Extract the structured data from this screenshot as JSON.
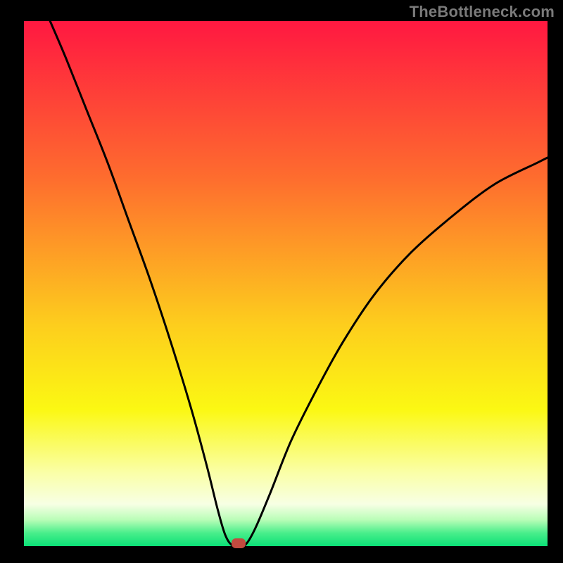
{
  "watermark": "TheBottleneck.com",
  "chart_data": {
    "type": "line",
    "title": "",
    "xlabel": "",
    "ylabel": "",
    "xlim": [
      0,
      100
    ],
    "ylim": [
      0,
      100
    ],
    "notes": "V-shaped bottleneck curve centered near x≈41. Background gradient top→bottom: red→orange→yellow→cream with a thin green band at bottom and a small red marker at the minimum. No axis ticks or labels visible.",
    "marker": {
      "x": 41,
      "y": 0,
      "color": "#c24a3f"
    },
    "gradient_stops": [
      {
        "offset": 0,
        "color": "#ff1841"
      },
      {
        "offset": 30,
        "color": "#fe6d2e"
      },
      {
        "offset": 58,
        "color": "#fdce1d"
      },
      {
        "offset": 74,
        "color": "#fbf813"
      },
      {
        "offset": 86,
        "color": "#faffa7"
      },
      {
        "offset": 92,
        "color": "#f7ffe4"
      },
      {
        "offset": 95,
        "color": "#b9fdb7"
      },
      {
        "offset": 97.5,
        "color": "#49ee8b"
      },
      {
        "offset": 100,
        "color": "#0be077"
      }
    ],
    "curve_points": [
      {
        "x": 5,
        "y": 100
      },
      {
        "x": 8,
        "y": 93
      },
      {
        "x": 12,
        "y": 83
      },
      {
        "x": 16,
        "y": 73
      },
      {
        "x": 20,
        "y": 62
      },
      {
        "x": 24,
        "y": 51
      },
      {
        "x": 28,
        "y": 39
      },
      {
        "x": 32,
        "y": 26
      },
      {
        "x": 35,
        "y": 15
      },
      {
        "x": 37,
        "y": 7
      },
      {
        "x": 38.5,
        "y": 2
      },
      {
        "x": 40,
        "y": 0
      },
      {
        "x": 42,
        "y": 0
      },
      {
        "x": 44,
        "y": 3
      },
      {
        "x": 47,
        "y": 10
      },
      {
        "x": 51,
        "y": 20
      },
      {
        "x": 56,
        "y": 30
      },
      {
        "x": 61,
        "y": 39
      },
      {
        "x": 67,
        "y": 48
      },
      {
        "x": 74,
        "y": 56
      },
      {
        "x": 82,
        "y": 63
      },
      {
        "x": 90,
        "y": 69
      },
      {
        "x": 98,
        "y": 73
      },
      {
        "x": 100,
        "y": 74
      }
    ]
  }
}
